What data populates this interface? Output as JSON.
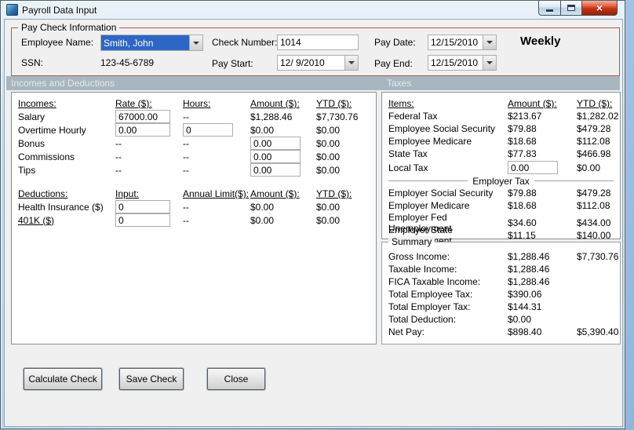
{
  "window": {
    "title": "Payroll Data Input"
  },
  "paycheck": {
    "group_title": "Pay Check Information",
    "employee_name_label": "Employee Name:",
    "employee_name_value": "Smith, John",
    "ssn_label": "SSN:",
    "ssn_value": "123-45-6789",
    "check_number_label": "Check Number:",
    "check_number_value": "1014",
    "pay_start_label": "Pay Start:",
    "pay_start_value": "12/ 9/2010",
    "pay_date_label": "Pay Date:",
    "pay_date_value": "12/15/2010",
    "pay_end_label": "Pay End:",
    "pay_end_value": "12/15/2010",
    "frequency": "Weekly"
  },
  "sections": {
    "incomes_header": "Incomes and Deductions",
    "taxes_header": "Taxes"
  },
  "incomes": {
    "headers": {
      "name": "Incomes:",
      "rate": "Rate ($):",
      "hours": "Hours:",
      "amount": "Amount ($):",
      "ytd": "YTD ($):"
    },
    "rows": [
      {
        "name": "Salary",
        "rate": "67000.00",
        "hours": "--",
        "amount": "$1,288.46",
        "ytd": "$7,730.76"
      },
      {
        "name": "Overtime Hourly",
        "rate": "0.00",
        "hours": "0",
        "amount": "$0.00",
        "ytd": "$0.00"
      },
      {
        "name": "Bonus",
        "rate": "--",
        "hours": "--",
        "amount": "0.00",
        "ytd": "$0.00"
      },
      {
        "name": "Commissions",
        "rate": "--",
        "hours": "--",
        "amount": "0.00",
        "ytd": "$0.00"
      },
      {
        "name": "Tips",
        "rate": "--",
        "hours": "--",
        "amount": "0.00",
        "ytd": "$0.00"
      }
    ]
  },
  "deductions": {
    "headers": {
      "name": "Deductions:",
      "input": "Input:",
      "limit": "Annual Limit($):",
      "amount": "Amount ($):",
      "ytd": "YTD ($):"
    },
    "rows": [
      {
        "name": "Health Insurance  ($)",
        "input": "0",
        "limit": "--",
        "amount": "$0.00",
        "ytd": "$0.00"
      },
      {
        "name": "401K  ($)",
        "input": "0",
        "limit": "--",
        "amount": "$0.00",
        "ytd": "$0.00"
      }
    ]
  },
  "taxes": {
    "headers": {
      "items": "Items:",
      "amount": "Amount ($):",
      "ytd": "YTD ($):"
    },
    "employee_rows": [
      {
        "name": "Federal Tax",
        "amount": "$213.67",
        "ytd": "$1,282.02"
      },
      {
        "name": "Employee Social Security",
        "amount": "$79.88",
        "ytd": "$479.28"
      },
      {
        "name": "Employee Medicare",
        "amount": "$18.68",
        "ytd": "$112.08"
      },
      {
        "name": "State Tax",
        "amount": "$77.83",
        "ytd": "$466.98"
      }
    ],
    "local_tax": {
      "name": "Local Tax",
      "amount": "0.00",
      "ytd": "$0.00"
    },
    "employer_header": "Employer Tax",
    "employer_rows": [
      {
        "name": "Employer Social Security",
        "amount": "$79.88",
        "ytd": "$479.28"
      },
      {
        "name": "Employer Medicare",
        "amount": "$18.68",
        "ytd": "$112.08"
      },
      {
        "name": "Employer Fed Unemployment",
        "amount": "$34.60",
        "ytd": "$434.00"
      },
      {
        "name": "Employer State Unemployment",
        "amount": "$11.15",
        "ytd": "$140.00"
      }
    ]
  },
  "summary": {
    "title": "Summary",
    "rows": [
      {
        "name": "Gross Income:",
        "amount": "$1,288.46",
        "ytd": "$7,730.76"
      },
      {
        "name": "Taxable Income:",
        "amount": "$1,288.46",
        "ytd": ""
      },
      {
        "name": "FICA Taxable Income:",
        "amount": "$1,288.46",
        "ytd": ""
      },
      {
        "name": "Total Employee Tax:",
        "amount": "$390.06",
        "ytd": ""
      },
      {
        "name": "Total Employer Tax:",
        "amount": "$144.31",
        "ytd": ""
      },
      {
        "name": "Total Deduction:",
        "amount": "$0.00",
        "ytd": ""
      },
      {
        "name": "Net Pay:",
        "amount": "$898.40",
        "ytd": "$5,390.40"
      }
    ]
  },
  "buttons": {
    "calculate": "Calculate Check",
    "save": "Save Check",
    "close": "Close"
  }
}
